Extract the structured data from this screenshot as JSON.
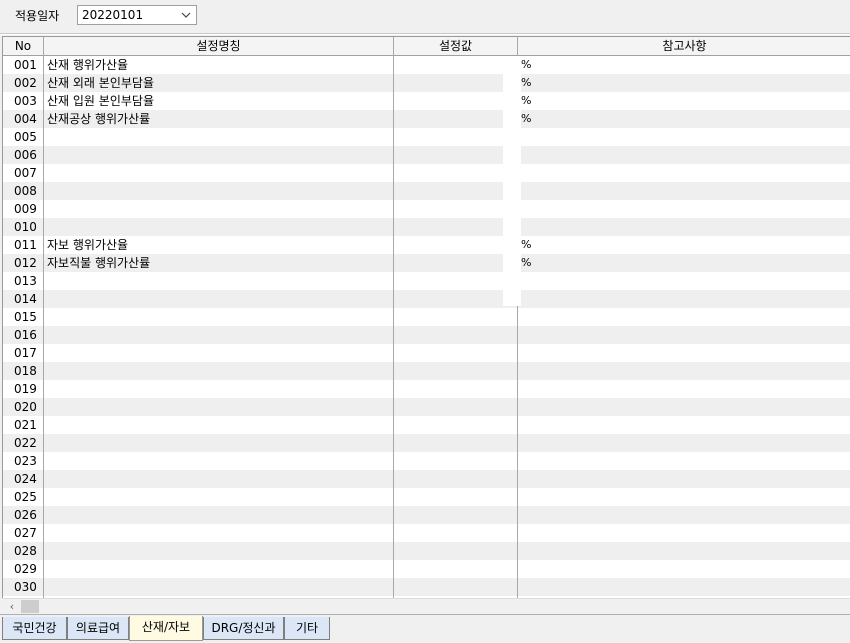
{
  "toolbar": {
    "date_label": "적용일자",
    "date_value": "20220101"
  },
  "grid": {
    "columns": [
      "No",
      "설정명칭",
      "설정값",
      "참고사항"
    ],
    "rows": [
      {
        "no": "001",
        "name": "산재 행위가산율",
        "unit": "%"
      },
      {
        "no": "002",
        "name": "산재 외래 본인부담율",
        "unit": "%"
      },
      {
        "no": "003",
        "name": "산재 입원 본인부담율",
        "unit": "%"
      },
      {
        "no": "004",
        "name": "산재공상 행위가산률",
        "unit": "%"
      },
      {
        "no": "005",
        "name": "",
        "unit": ""
      },
      {
        "no": "006",
        "name": "",
        "unit": ""
      },
      {
        "no": "007",
        "name": "",
        "unit": ""
      },
      {
        "no": "008",
        "name": "",
        "unit": ""
      },
      {
        "no": "009",
        "name": "",
        "unit": ""
      },
      {
        "no": "010",
        "name": "",
        "unit": ""
      },
      {
        "no": "011",
        "name": "자보 행위가산율",
        "unit": "%"
      },
      {
        "no": "012",
        "name": "자보직불 행위가산률",
        "unit": "%"
      },
      {
        "no": "013",
        "name": "",
        "unit": ""
      },
      {
        "no": "014",
        "name": "",
        "unit": ""
      },
      {
        "no": "015",
        "name": "",
        "unit": ""
      },
      {
        "no": "016",
        "name": "",
        "unit": ""
      },
      {
        "no": "017",
        "name": "",
        "unit": ""
      },
      {
        "no": "018",
        "name": "",
        "unit": ""
      },
      {
        "no": "019",
        "name": "",
        "unit": ""
      },
      {
        "no": "020",
        "name": "",
        "unit": ""
      },
      {
        "no": "021",
        "name": "",
        "unit": ""
      },
      {
        "no": "022",
        "name": "",
        "unit": ""
      },
      {
        "no": "023",
        "name": "",
        "unit": ""
      },
      {
        "no": "024",
        "name": "",
        "unit": ""
      },
      {
        "no": "025",
        "name": "",
        "unit": ""
      },
      {
        "no": "026",
        "name": "",
        "unit": ""
      },
      {
        "no": "027",
        "name": "",
        "unit": ""
      },
      {
        "no": "028",
        "name": "",
        "unit": ""
      },
      {
        "no": "029",
        "name": "",
        "unit": ""
      },
      {
        "no": "030",
        "name": "",
        "unit": ""
      }
    ]
  },
  "tabs": [
    {
      "label": "국민건강",
      "active": false
    },
    {
      "label": "의료급여",
      "active": false
    },
    {
      "label": "산재/자보",
      "active": true
    },
    {
      "label": "DRG/정신과",
      "active": false
    },
    {
      "label": "기타",
      "active": false
    }
  ],
  "colors": {
    "row_alt": "#efefef",
    "tab_inactive": "#dbe7f6",
    "tab_active": "#fffbe3"
  }
}
